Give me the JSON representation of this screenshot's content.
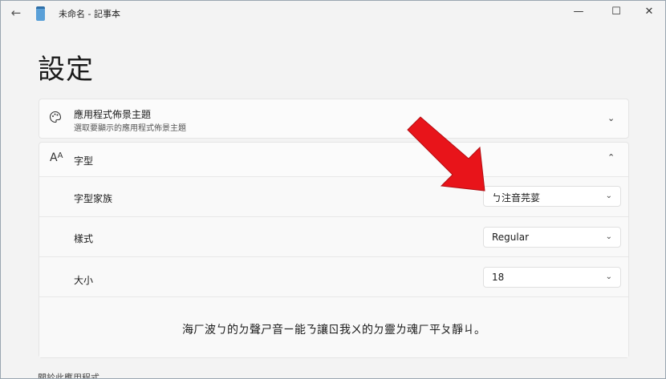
{
  "window": {
    "title": "未命名 - 記事本",
    "back_icon": "back-arrow-icon",
    "minimize": "—",
    "maximize": "☐",
    "close": "✕"
  },
  "page": {
    "heading": "設定"
  },
  "theme": {
    "icon": "palette-icon",
    "title": "應用程式佈景主題",
    "subtitle": "選取要顯示的應用程式佈景主題"
  },
  "font": {
    "icon": "font-icon",
    "title": "字型",
    "rows": [
      {
        "label": "字型家族",
        "value": "ㄅ注音芫荽"
      },
      {
        "label": "樣式",
        "value": "Regular"
      },
      {
        "label": "大小",
        "value": "18"
      }
    ],
    "preview": "海ㄏ波ㄅ的ㄉ聲ㄕ音ㄧ能ㄋ讓ㄖ我ㄨ的ㄉ靈ㄌ魂ㄏ平ㄆ靜ㄐ。"
  },
  "footer": {
    "text": "關於此應用程式"
  },
  "colors": {
    "annotation_arrow": "#e8141a",
    "accent": "#0067c0"
  }
}
